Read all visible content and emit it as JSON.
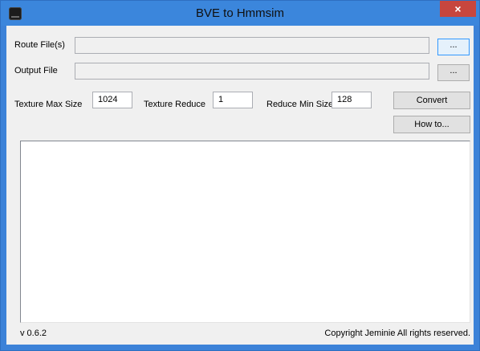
{
  "window": {
    "title": "BVE to Hmmsim",
    "close_glyph": "×"
  },
  "form": {
    "route_label": "Route File(s)",
    "route_value": "",
    "route_browse": "...",
    "output_label": "Output File",
    "output_value": "",
    "output_browse": "...",
    "tex_max_label": "Texture Max Size",
    "tex_max_value": "1024",
    "tex_reduce_label": "Texture Reduce",
    "tex_reduce_value": "1",
    "reduce_min_label": "Reduce Min Size",
    "reduce_min_value": "128",
    "convert_label": "Convert",
    "howto_label": "How to..."
  },
  "log": {
    "content": ""
  },
  "footer": {
    "version": "v 0.6.2",
    "copyright": "Copyright Jeminie All rights reserved."
  },
  "colors": {
    "title_bar": "#3b86dc",
    "close_button": "#c7463e",
    "focus_border": "#3399ff"
  }
}
